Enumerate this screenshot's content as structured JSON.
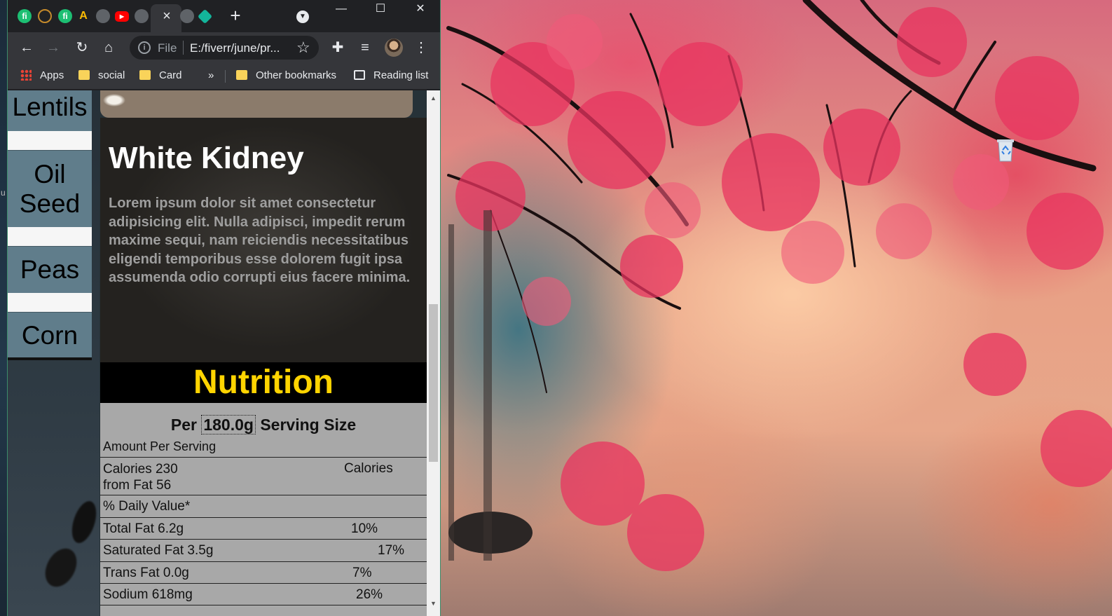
{
  "browser": {
    "tab_close": "×",
    "new_tab": "+",
    "window_buttons": {
      "minimize": "—",
      "maximize": "☐",
      "close": "✕"
    },
    "favicons": [
      {
        "name": "fiverr-favicon-icon",
        "color": "#1dbf73",
        "glyph": "fi"
      },
      {
        "name": "laurel-favicon-icon",
        "color": "#c58a2b",
        "glyph": ""
      },
      {
        "name": "fiverr-favicon-icon",
        "color": "#1dbf73",
        "glyph": "fi"
      },
      {
        "name": "google-ads-favicon-icon",
        "color": "#fbbc04",
        "glyph": "A"
      },
      {
        "name": "globe-favicon-icon",
        "color": "#5f6368",
        "glyph": ""
      },
      {
        "name": "youtube-favicon-icon",
        "color": "#ff0000",
        "glyph": "▶"
      },
      {
        "name": "globe-favicon-icon",
        "color": "#5f6368",
        "glyph": ""
      },
      {
        "name": "globe-favicon-icon",
        "color": "#5f6368",
        "glyph": ""
      },
      {
        "name": "diamond-favicon-icon",
        "color": "#13b59b",
        "glyph": ""
      }
    ],
    "address": {
      "scheme_label": "File",
      "url": "E:/fiverr/june/pr..."
    },
    "bookmarks": [
      {
        "label": "Apps",
        "icon": "apps-grid-icon"
      },
      {
        "label": "social",
        "icon": "folder-icon"
      },
      {
        "label": "Card",
        "icon": "folder-icon"
      },
      {
        "label": "»",
        "icon": ""
      },
      {
        "label": "Other bookmarks",
        "icon": "folder-icon"
      },
      {
        "label": "Reading list",
        "icon": "reading-list-icon"
      }
    ]
  },
  "page": {
    "nav": [
      "Lentils",
      "Oil Seed",
      "Peas",
      "Corn"
    ],
    "card": {
      "title": "White Kidney",
      "description": "Lorem ipsum dolor sit amet consectetur adipisicing elit. Nulla adipisci, impedit rerum maxime sequi, nam reiciendis necessitatibus eligendi temporibus esse dolorem fugit ipsa assumenda odio corrupti eius facere minima."
    },
    "nutrition": {
      "heading": "Nutrition",
      "serving_prefix": "Per",
      "serving_value": "180.0g",
      "serving_suffix": "Serving Size",
      "amount_label": "Amount Per Serving",
      "calories_line1": "Calories 230",
      "calories_line2": "from Fat 56",
      "calories_right": "Calories",
      "daily_value_label": "% Daily Value*",
      "rows": [
        {
          "label": "Total Fat 6.2g",
          "value": "10%"
        },
        {
          "label": "Saturated Fat 3.5g",
          "value": "17%"
        },
        {
          "label": "Trans Fat 0.0g",
          "value": "7%"
        },
        {
          "label": "Sodium 618mg",
          "value": "26%"
        }
      ]
    },
    "colors": {
      "nav_bg": "#607d8b",
      "heading_yellow": "#ffd400",
      "table_bg": "#a8a8a8"
    }
  },
  "desktop": {
    "icons": [
      {
        "name": "recycle-bin-icon"
      }
    ]
  },
  "left_edge_fragment": "u"
}
